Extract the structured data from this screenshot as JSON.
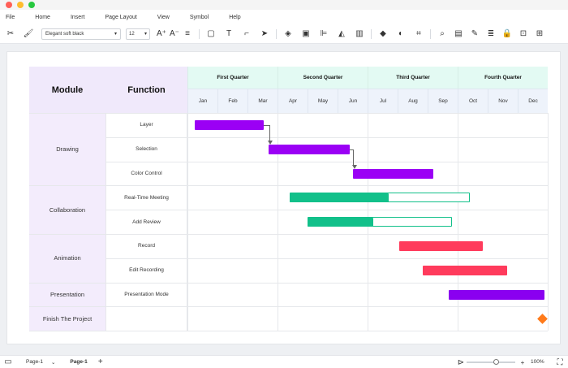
{
  "menu": [
    "File",
    "Home",
    "Insert",
    "Page Layout",
    "View",
    "Symbol",
    "Help"
  ],
  "toolbar": {
    "font_name": "Elegant soft black",
    "font_size": "12"
  },
  "chart_data": {
    "type": "gantt",
    "column_headers": {
      "module": "Module",
      "function": "Function"
    },
    "quarters": [
      "First Quarter",
      "Second Quarter",
      "Third Quarter",
      "Fourth Quarter"
    ],
    "months": [
      "Jan",
      "Feb",
      "Mar",
      "Apr",
      "May",
      "Jun",
      "Jul",
      "Aug",
      "Sep",
      "Oct",
      "Nov",
      "Dec"
    ],
    "modules": [
      {
        "name": "Drawing",
        "rows": 3
      },
      {
        "name": "Collaboration",
        "rows": 2
      },
      {
        "name": "Animation",
        "rows": 2
      },
      {
        "name": "Presentation",
        "rows": 1
      },
      {
        "name": "Finish The Project",
        "rows": 1
      }
    ],
    "tasks": [
      {
        "function": "Layer",
        "start": 0.25,
        "end": 2.55,
        "color": "#9b00f5"
      },
      {
        "function": "Selection",
        "start": 2.7,
        "end": 5.4,
        "color": "#9b00f5"
      },
      {
        "function": "Color Control",
        "start": 5.5,
        "end": 8.2,
        "color": "#9b00f5"
      },
      {
        "function": "Real-Time Meeting",
        "start": 3.4,
        "end": 9.4,
        "progress_end": 6.7,
        "color": "#12c08a"
      },
      {
        "function": "Add Review",
        "start": 4.0,
        "end": 8.8,
        "progress_end": 6.2,
        "color": "#12c08a"
      },
      {
        "function": "Record",
        "start": 7.05,
        "end": 9.85,
        "color": "#ff3b5c"
      },
      {
        "function": "Edit Recording",
        "start": 7.85,
        "end": 10.65,
        "color": "#ff3b5c"
      },
      {
        "function": "Presentation Mode",
        "start": 8.7,
        "end": 11.9,
        "color": "#8a00f0"
      },
      {
        "function": "",
        "milestone": 11.85,
        "color": "#ff7a1a"
      }
    ],
    "dependencies": [
      [
        0,
        1
      ],
      [
        1,
        2
      ]
    ]
  },
  "pages": {
    "current": "Page-1",
    "tab": "Page-1"
  },
  "zoom": "100%"
}
